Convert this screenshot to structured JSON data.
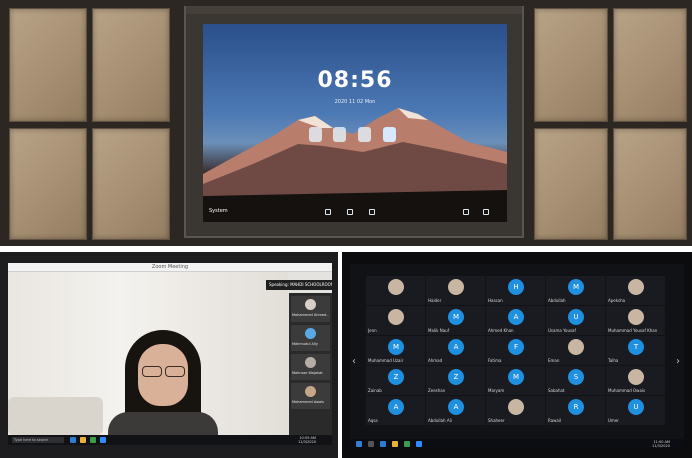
{
  "top_display": {
    "clock": "08:56",
    "date_line": "2020 11 02 Mon",
    "dock_label": "System"
  },
  "video_call": {
    "window_title": "Zoom Meeting",
    "speaking_banner": "Speaking: MAHDI SCHOOLROOM",
    "participants": [
      {
        "name": "Mohammed Ahmed...",
        "avatar_color": "#d8d0c8"
      },
      {
        "name": "Mahmudul Ally",
        "avatar_color": "#5aa9e6"
      },
      {
        "name": "Mahnoor Wajahat",
        "avatar_color": "#b5aea5"
      },
      {
        "name": "Mohammed Awais",
        "avatar_color": "#c7a588"
      }
    ],
    "search_text": "Type here to search",
    "taskbar_time": "10:59 AM",
    "taskbar_date": "11/3/2020"
  },
  "grid_call": {
    "tiles": [
      {
        "letter": "",
        "name": "",
        "photo": true
      },
      {
        "letter": "",
        "name": "Haider",
        "photo": true
      },
      {
        "letter": "H",
        "name": "Hassan",
        "photo": false
      },
      {
        "letter": "M",
        "name": "Abdullah",
        "photo": false
      },
      {
        "letter": "",
        "name": "Apeksha",
        "photo": true
      },
      {
        "letter": "",
        "name": "Jenn",
        "photo": true
      },
      {
        "letter": "M",
        "name": "Malik Nauf",
        "photo": false
      },
      {
        "letter": "A",
        "name": "Ahmed Khan",
        "photo": false
      },
      {
        "letter": "U",
        "name": "Usama Yousaf",
        "photo": false
      },
      {
        "letter": "",
        "name": "Muhammad Yousaf Khan",
        "photo": true
      },
      {
        "letter": "M",
        "name": "Muhammad Uzair",
        "photo": false
      },
      {
        "letter": "A",
        "name": "Ahmad",
        "photo": false
      },
      {
        "letter": "F",
        "name": "Fatima",
        "photo": false
      },
      {
        "letter": "",
        "name": "Eman",
        "photo": true
      },
      {
        "letter": "T",
        "name": "Talha",
        "photo": false
      },
      {
        "letter": "Z",
        "name": "Zainab",
        "photo": false
      },
      {
        "letter": "Z",
        "name": "Zeeshan",
        "photo": false
      },
      {
        "letter": "M",
        "name": "Maryam",
        "photo": false
      },
      {
        "letter": "S",
        "name": "Sabahat",
        "photo": false
      },
      {
        "letter": "",
        "name": "Muhammad Owais",
        "photo": true
      },
      {
        "letter": "A",
        "name": "Aqsa",
        "photo": false
      },
      {
        "letter": "A",
        "name": "Abdullah Ali",
        "photo": false
      },
      {
        "letter": "",
        "name": "Shaheer",
        "photo": true
      },
      {
        "letter": "R",
        "name": "Rawail",
        "photo": false
      },
      {
        "letter": "U",
        "name": "Umer",
        "photo": false
      }
    ],
    "taskbar_time": "11:00 AM",
    "taskbar_date": "11/3/2020"
  }
}
